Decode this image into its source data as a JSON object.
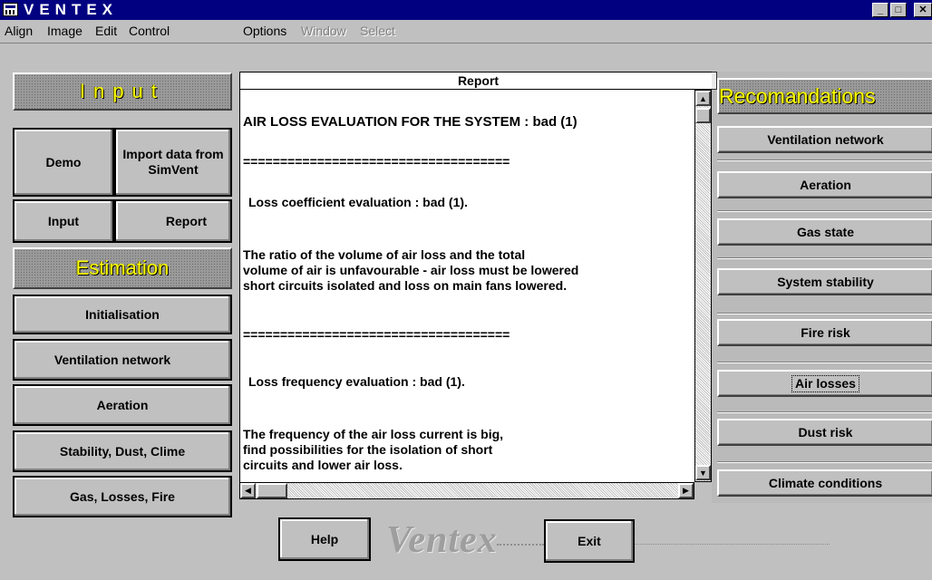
{
  "window": {
    "title": "VENTEX"
  },
  "menubar": {
    "items": [
      {
        "label": "Align",
        "enabled": true
      },
      {
        "label": "Image",
        "enabled": true
      },
      {
        "label": "Edit",
        "enabled": true
      },
      {
        "label": "Control",
        "enabled": true
      },
      {
        "label": "Options",
        "enabled": true
      },
      {
        "label": "Window",
        "enabled": false
      },
      {
        "label": "Select",
        "enabled": false
      }
    ]
  },
  "input_panel": {
    "heading": "Input",
    "demo_label": "Demo",
    "import_label": "Import data from SimVent",
    "input_label": "Input",
    "report_label": "Report"
  },
  "estimation_panel": {
    "heading": "Estimation",
    "buttons": [
      "Initialisation",
      "Ventilation network",
      "Aeration",
      "Stability, Dust, Clime",
      "Gas, Losses, Fire"
    ]
  },
  "report": {
    "title": "Report",
    "lines": [
      "AIR LOSS EVALUATION FOR THE SYSTEM : bad (1)",
      "====================================",
      "Loss coefficient evaluation : bad (1).",
      "The ratio of the volume of air loss and the total",
      "volume of air is unfavourable - air loss must be lowered",
      "short circuits isolated and loss on main fans lowered.",
      "====================================",
      "Loss frequency evaluation : bad (1).",
      "The frequency of the air loss current is big,",
      "find possibilities for the isolation of short",
      "circuits and lower air loss."
    ]
  },
  "recommendations": {
    "heading": "Recomandations",
    "buttons": [
      "Ventilation network",
      "Aeration",
      "Gas state",
      "System stability",
      "Fire risk",
      "Air losses",
      "Dust risk",
      "Climate conditions"
    ],
    "selected": "Air losses"
  },
  "footer": {
    "help_label": "Help",
    "exit_label": "Exit",
    "logo_text": "Ventex"
  },
  "colors": {
    "title_bar": "#000080",
    "heading_text": "#ffff00",
    "face": "#c0c0c0"
  }
}
